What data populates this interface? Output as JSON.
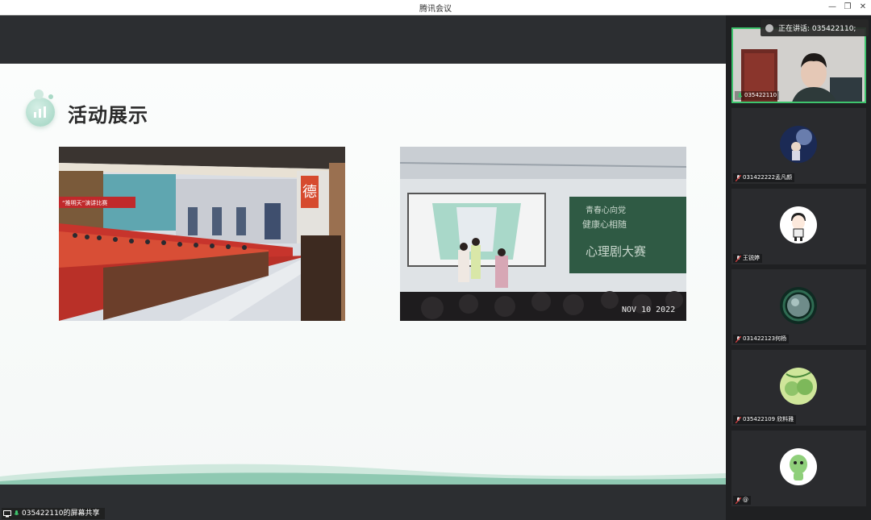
{
  "window": {
    "title": "腾讯会议"
  },
  "slide": {
    "title": "活动展示",
    "photo1_banner": "“推明天”演讲比赛",
    "photo1_seal": "德",
    "photo2_board_line1": "青春心向党",
    "photo2_board_line2": "健康心相随",
    "photo2_board_line3": "心理剧大赛",
    "photo2_timestamp": "NOV 10 2022"
  },
  "share": {
    "label": "035422110的屏幕共享"
  },
  "speaking": {
    "label": "正在讲话: 035422110;"
  },
  "participants": [
    {
      "name": "035422110",
      "mic": "on"
    },
    {
      "name": "031422222孟凡颜",
      "mic": "muted"
    },
    {
      "name": "王锐婷",
      "mic": "muted"
    },
    {
      "name": "031422123何杨",
      "mic": "muted"
    },
    {
      "name": "035422109 欣料雅",
      "mic": "muted"
    },
    {
      "name": "@",
      "mic": "muted"
    }
  ],
  "colors": {
    "accent": "#3ec46d",
    "panel_bg": "#1f2022",
    "slide_green": "#9ed3c0"
  }
}
